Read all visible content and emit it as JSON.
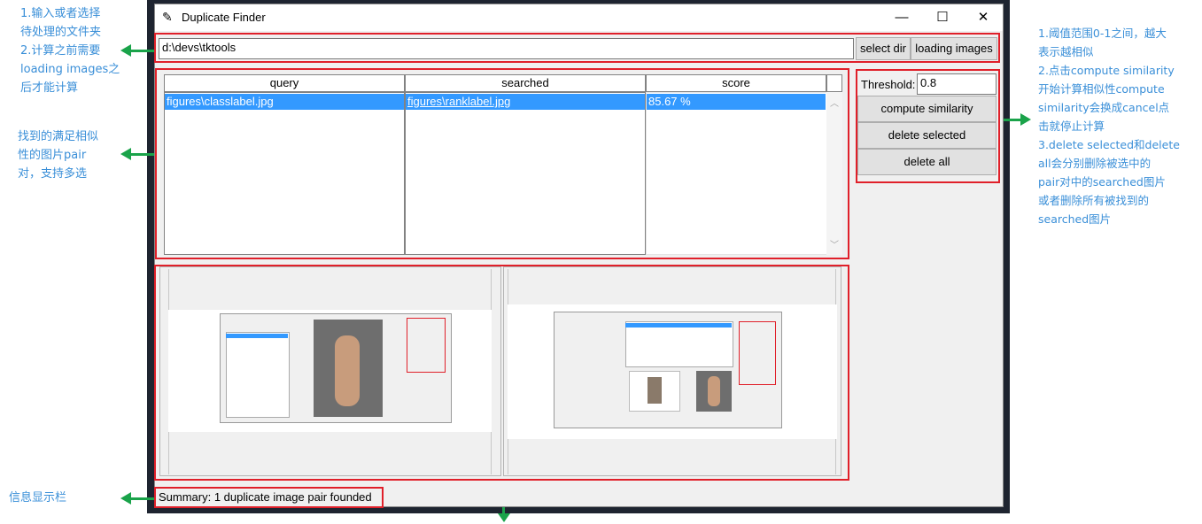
{
  "annotations": {
    "left_top": "1.输入或者选择\n待处理的文件夹\n2.计算之前需要\nloading images之\n后才能计算",
    "left_mid": "找到的满足相似\n性的图片pair\n对，支持多选",
    "left_bottom": "信息显示栏",
    "right": "1.阈值范围0-1之间，越大\n表示越相似\n2.点击compute similarity\n开始计算相似性compute\nsimilarity会换成cancel点\n击就停止计算\n3.delete selected和delete\nall会分别删除被选中的\npair对中的searched图片\n或者删除所有被找到的\nsearched图片"
  },
  "window": {
    "title": "Duplicate Finder",
    "minimize": "—",
    "maximize": "☐",
    "close": "✕"
  },
  "toolbar": {
    "dir_value": "d:\\devs\\tktools",
    "select_dir": "select dir",
    "loading_images": "loading images"
  },
  "table": {
    "headers": [
      "query",
      "searched",
      "score"
    ],
    "rows": [
      {
        "query": "figures\\classlabel.jpg",
        "searched": "figures\\ranklabel.jpg",
        "score": "85.67 %"
      }
    ]
  },
  "controls": {
    "threshold_label": "Threshold:",
    "threshold_value": "0.8",
    "compute": "compute similarity",
    "delete_selected": "delete selected",
    "delete_all": "delete all"
  },
  "summary": "Summary: 1 duplicate image pair founded",
  "colors": {
    "annotation": "#3a8fd8",
    "highlight_box": "#e0202a",
    "arrow": "#1aa34a",
    "selection": "#3399ff"
  }
}
